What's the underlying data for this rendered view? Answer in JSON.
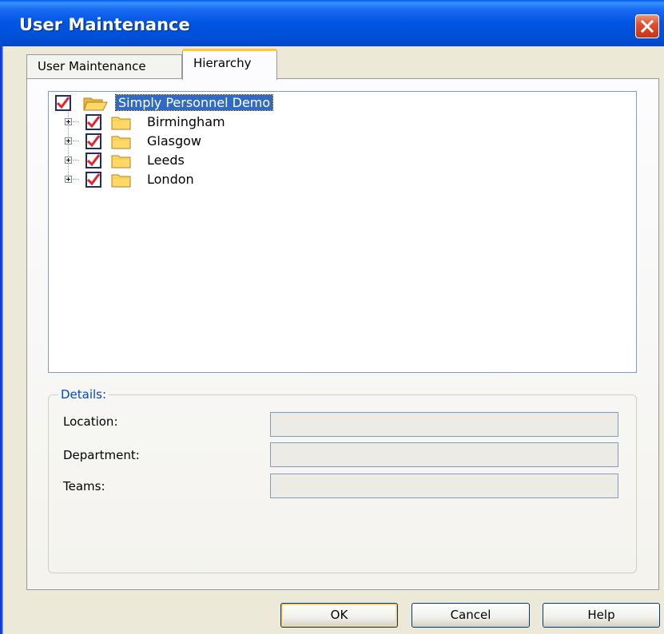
{
  "window": {
    "title": "User Maintenance"
  },
  "tabs": [
    {
      "label": "User Maintenance",
      "active": false
    },
    {
      "label": "Hierarchy",
      "active": true
    }
  ],
  "tree": {
    "root": {
      "label": "Simply Personnel Demo",
      "checked": true,
      "selected": true,
      "icon": "folder-open-icon"
    },
    "children": [
      {
        "label": "Birmingham",
        "checked": true,
        "expanded": false,
        "icon": "folder-icon"
      },
      {
        "label": "Glasgow",
        "checked": true,
        "expanded": false,
        "icon": "folder-icon"
      },
      {
        "label": "Leeds",
        "checked": true,
        "expanded": false,
        "icon": "folder-icon"
      },
      {
        "label": "London",
        "checked": true,
        "expanded": false,
        "icon": "folder-icon"
      }
    ]
  },
  "details": {
    "legend": "Details:",
    "location_label": "Location:",
    "location_value": "",
    "department_label": "Department:",
    "department_value": "",
    "teams_label": "Teams:",
    "teams_value": ""
  },
  "buttons": {
    "ok": "OK",
    "cancel": "Cancel",
    "help": "Help"
  },
  "colors": {
    "titlebar": "#0054e3",
    "selection": "#316ac5",
    "details_legend": "#0046d5",
    "checkmark": "#e8202a"
  }
}
